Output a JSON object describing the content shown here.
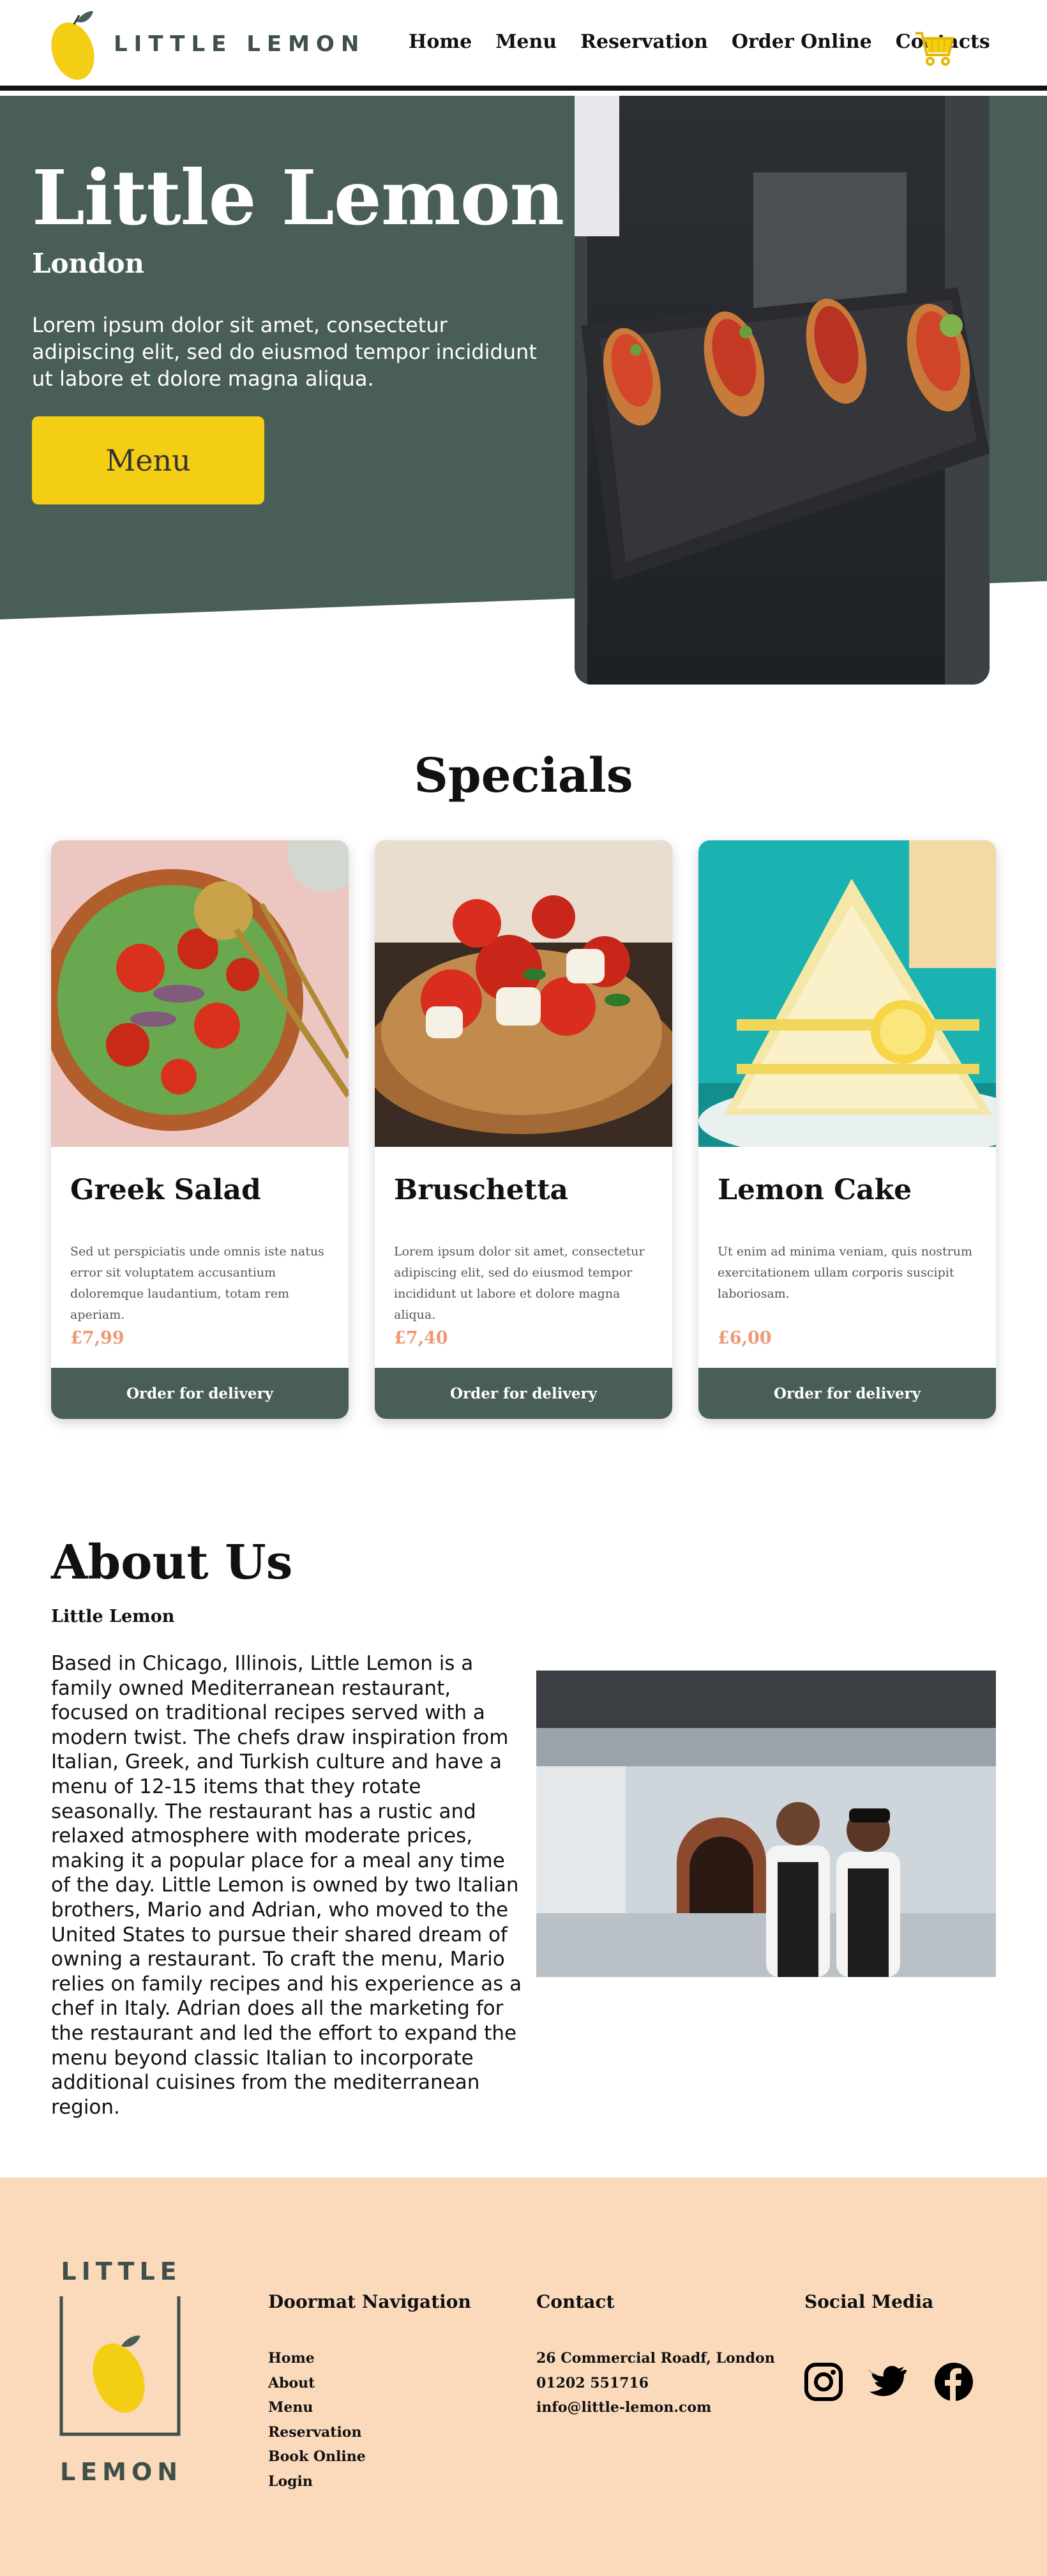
{
  "header": {
    "logo_text": "LITTLE LEMON",
    "nav": [
      "Home",
      "Menu",
      "Reservation",
      "Order Online",
      "Contacts"
    ],
    "cart_icon": "cart-icon"
  },
  "hero": {
    "title": "Little Lemon",
    "subtitle": "London",
    "text": "Lorem ipsum dolor sit amet, consectetur adipiscing elit, sed do eiusmod tempor incididunt ut labore et dolore magna aliqua.",
    "button": "Menu"
  },
  "specials": {
    "title": "Specials",
    "cards": [
      {
        "name": "Greek Salad",
        "desc": "Sed ut perspiciatis unde omnis iste natus error sit voluptatem accusantium doloremque laudantium, totam rem aperiam.",
        "price": "£7,99",
        "button": "Order for delivery"
      },
      {
        "name": "Bruschetta",
        "desc": "Lorem ipsum dolor sit amet, consectetur adipiscing elit, sed do eiusmod tempor incididunt ut labore et dolore magna aliqua.",
        "price": "£7,40",
        "button": "Order for delivery"
      },
      {
        "name": "Lemon Cake",
        "desc": "Ut enim ad minima veniam, quis nostrum exercitationem ullam corporis suscipit laboriosam.",
        "price": "£6,00",
        "button": "Order for delivery"
      }
    ]
  },
  "about": {
    "title": "About Us",
    "subtitle": "Little Lemon",
    "text": "Based in Chicago, Illinois, Little Lemon is a family owned Mediterranean restaurant, focused on traditional recipes served with a modern twist. The chefs draw inspiration from Italian, Greek, and Turkish culture and have a menu of 12-15 items that they rotate seasonally. The restaurant has a rustic and relaxed atmosphere with moderate prices, making it a popular place for a meal any time of the day. Little Lemon is owned by two Italian brothers, Mario and Adrian, who moved to the United States to pursue their shared dream of owning a restaurant. To craft the menu, Mario relies on family recipes and his experience as a chef in Italy. Adrian does all the marketing for the restaurant and led the effort to expand the menu beyond classic Italian to incorporate additional cuisines from the mediterranean region."
  },
  "footer": {
    "logo_top": "LITTLE",
    "logo_bottom": "LEMON",
    "nav_title": "Doormat Navigation",
    "nav_items": [
      "Home",
      "About",
      "Menu",
      "Reservation",
      "Book Online",
      "Login"
    ],
    "contact_title": "Contact",
    "contact_items": [
      "26 Commercial Roadf, London",
      "01202 551716",
      "info@little-lemon.com"
    ],
    "social_title": "Social Media",
    "social_icons": [
      "instagram-icon",
      "twitter-icon",
      "facebook-icon"
    ]
  },
  "colors": {
    "primary_green": "#495e57",
    "primary_yellow": "#f4ce14",
    "salmon": "#ee9972",
    "peach": "#fbdabb"
  }
}
